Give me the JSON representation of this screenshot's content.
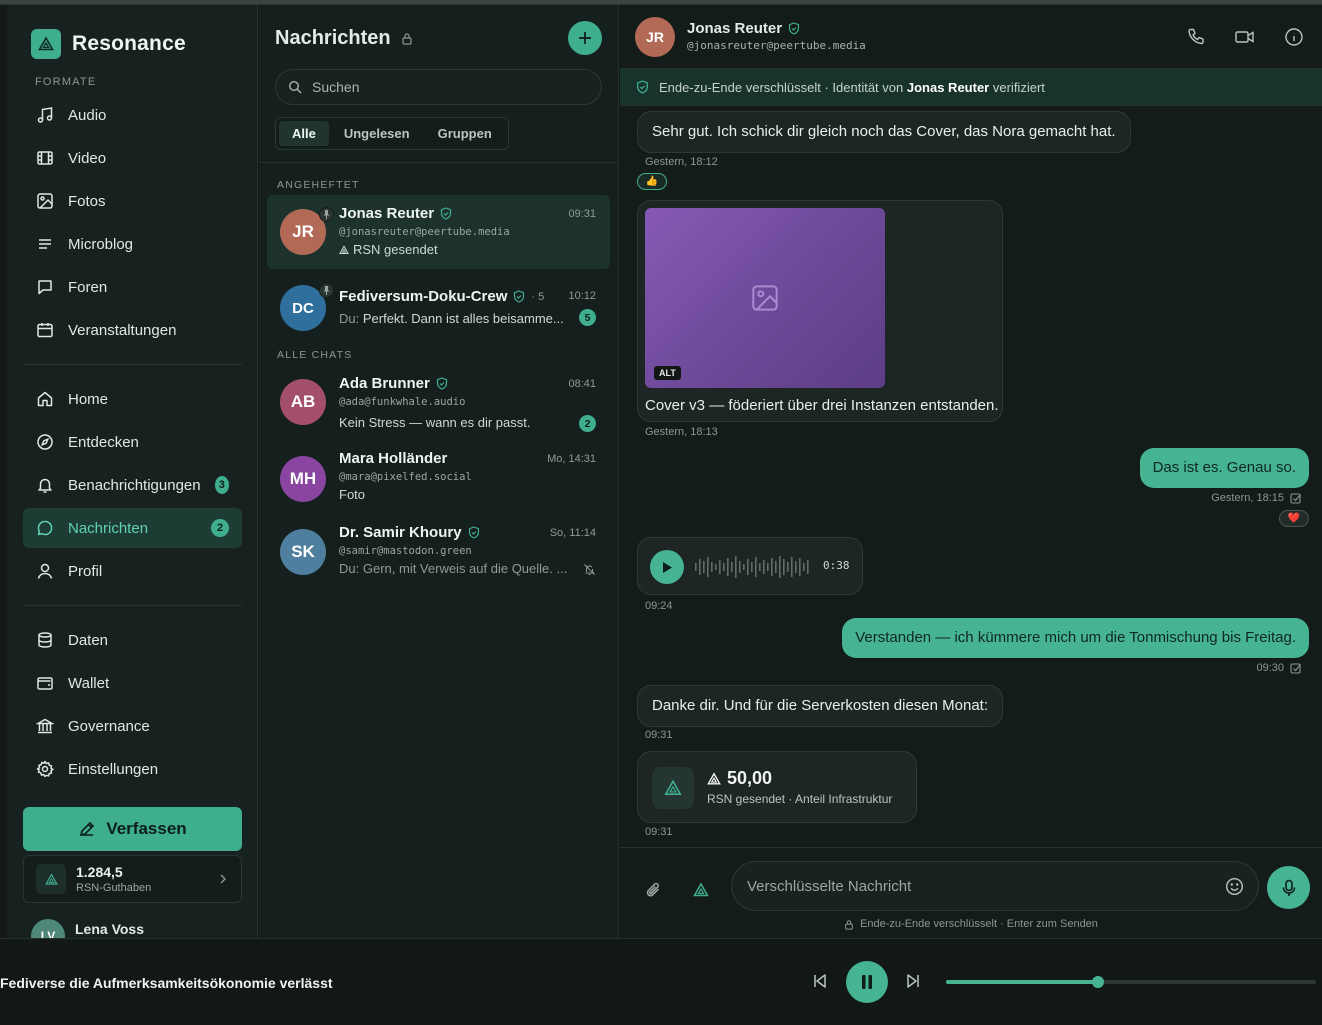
{
  "brand": {
    "name": "Resonance"
  },
  "sidebar": {
    "formats_label": "FORMATE",
    "formats": [
      {
        "label": "Audio",
        "icon": "music-note-icon"
      },
      {
        "label": "Video",
        "icon": "film-icon"
      },
      {
        "label": "Fotos",
        "icon": "image-icon"
      },
      {
        "label": "Microblog",
        "icon": "lines-icon"
      },
      {
        "label": "Foren",
        "icon": "speech-bubble-icon"
      },
      {
        "label": "Veranstaltungen",
        "icon": "calendar-icon"
      }
    ],
    "main": [
      {
        "label": "Home",
        "icon": "home-icon"
      },
      {
        "label": "Entdecken",
        "icon": "compass-icon"
      },
      {
        "label": "Benachrichtigungen",
        "icon": "bell-icon",
        "badge": "3"
      },
      {
        "label": "Nachrichten",
        "icon": "message-icon",
        "badge": "2",
        "active": true
      },
      {
        "label": "Profil",
        "icon": "user-icon"
      }
    ],
    "other": [
      {
        "label": "Daten",
        "icon": "database-icon"
      },
      {
        "label": "Wallet",
        "icon": "wallet-icon"
      },
      {
        "label": "Governance",
        "icon": "bank-icon"
      },
      {
        "label": "Einstellungen",
        "icon": "gear-icon"
      }
    ],
    "compose_label": "Verfassen",
    "wallet": {
      "amount": "1.284,5",
      "label": "RSN-Guthaben"
    },
    "user": {
      "initials": "LV",
      "name": "Lena Voss"
    }
  },
  "list": {
    "title": "Nachrichten",
    "search_placeholder": "Suchen",
    "tabs": [
      {
        "label": "Alle",
        "active": true
      },
      {
        "label": "Ungelesen"
      },
      {
        "label": "Gruppen"
      }
    ],
    "pinned_label": "ANGEHEFTET",
    "all_label": "ALLE CHATS",
    "pinned": [
      {
        "initials": "JR",
        "color": "#b26a57",
        "name": "Jonas Reuter",
        "time": "09:31",
        "handle": "@jonasreuter@peertube.media",
        "preview": "RSN gesendet"
      },
      {
        "initials": "DC",
        "color": "#2e6f9e",
        "name": "Fediversum-Doku-Crew",
        "members": "· 5",
        "time": "10:12",
        "preview_prefix": "Du:",
        "preview": "Perfekt. Dann ist alles beisamme...",
        "count": "5"
      }
    ],
    "chats": [
      {
        "initials": "AB",
        "color": "#a34f6c",
        "name": "Ada Brunner",
        "time": "08:41",
        "handle": "@ada@funkwhale.audio",
        "preview": "Kein Stress — wann es dir passt.",
        "count": "2"
      },
      {
        "initials": "MH",
        "color": "#8a45a1",
        "name": "Mara Holländer",
        "time": "Mo, 14:31",
        "handle": "@mara@pixelfed.social",
        "preview": "Foto"
      },
      {
        "initials": "SK",
        "color": "#4f7f9e",
        "name": "Dr. Samir Khoury",
        "time": "So, 11:14",
        "handle": "@samir@mastodon.green",
        "preview_prefix": "Du:",
        "preview": "Gern, mit Verweis auf die Quelle. ..."
      }
    ]
  },
  "chat": {
    "contact": {
      "initials": "JR",
      "name": "Jonas Reuter",
      "handle": "@jonasreuter@peertube.media"
    },
    "e2e": {
      "prefix": "Ende-zu-Ende verschlüsselt · Identität von",
      "name": "Jonas Reuter",
      "suffix": "verifiziert"
    },
    "messages": {
      "m1": {
        "text": "Sehr gut. Ich schick dir gleich noch das Cover, das Nora gemacht hat.",
        "time": "Gestern, 18:12",
        "reaction": "👍"
      },
      "m2": {
        "alt": "ALT",
        "caption": "Cover v3 — föderiert über drei Instanzen entstanden.",
        "time": "Gestern, 18:13"
      },
      "m3": {
        "text": "Das ist es. Genau so.",
        "time": "Gestern, 18:15",
        "reaction": "❤️"
      },
      "m4": {
        "duration": "0:38",
        "time": "09:24"
      },
      "m5": {
        "text": "Verstanden — ich kümmere mich um die Tonmischung bis Freitag.",
        "time": "09:30"
      },
      "m6": {
        "text": "Danke dir. Und für die Serverkosten diesen Monat:",
        "time": "09:31"
      },
      "m7": {
        "amount": "50,00",
        "sub": "RSN gesendet · Anteil Infrastruktur",
        "time": "09:31"
      }
    },
    "composer": {
      "placeholder": "Verschlüsselte Nachricht",
      "hint": "Ende-zu-Ende verschlüsselt · Enter zum Senden"
    }
  },
  "player": {
    "track": "Fediverse die Aufmerksamkeitsökonomie verlässt",
    "progress": 0.41
  },
  "colors": {
    "accent": "#46b393",
    "background": "#141c1a"
  }
}
